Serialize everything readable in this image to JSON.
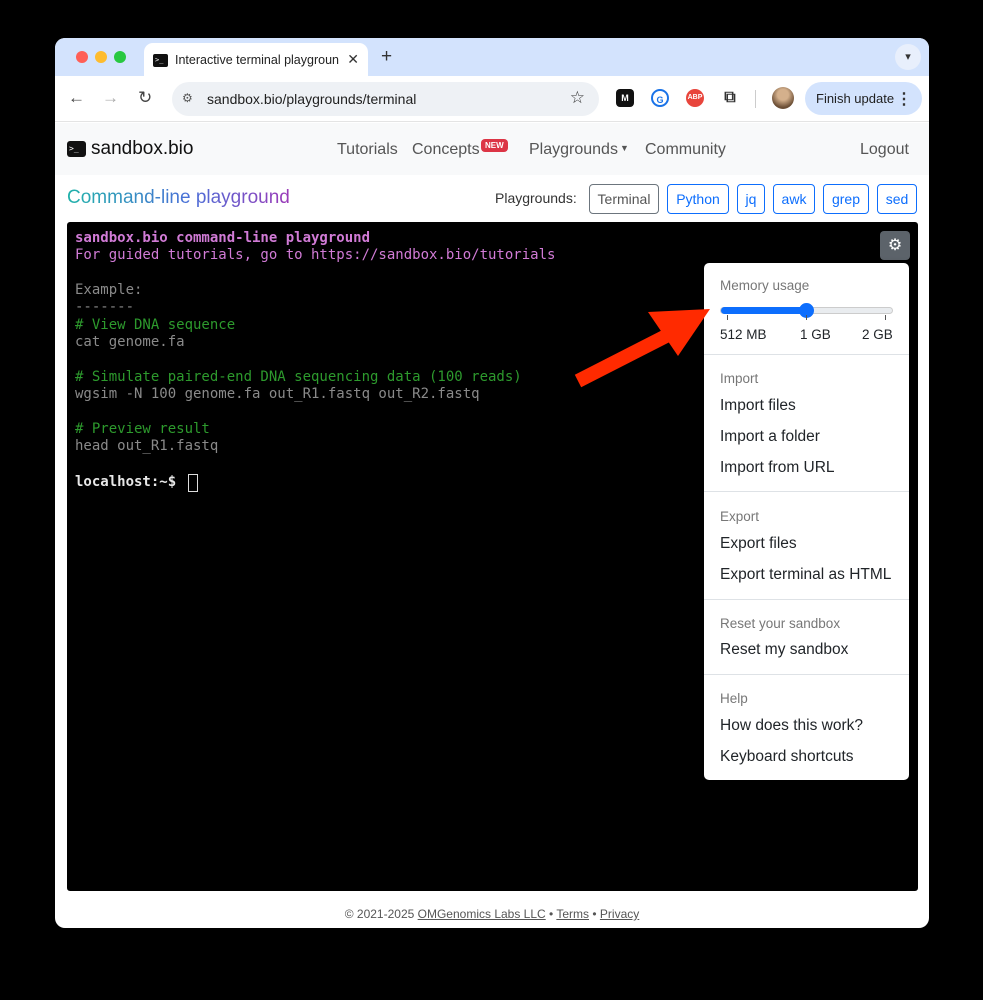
{
  "browser": {
    "tab_title": "Interactive terminal playground",
    "tab_close": "✕",
    "new_tab": "+",
    "url": "sandbox.bio/playgrounds/terminal",
    "finish_update_label": "Finish update",
    "extensions": [
      "M",
      "G",
      "ABP"
    ]
  },
  "nav": {
    "brand": "sandbox.bio",
    "brand_icon": ">_",
    "items": {
      "tutorials": "Tutorials",
      "concepts": "Concepts",
      "concepts_badge": "NEW",
      "playgrounds": "Playgrounds",
      "community": "Community"
    },
    "logout": "Logout"
  },
  "playground": {
    "title_prefix": "Command-line",
    "title_suffix": " playground",
    "label": "Playgrounds:",
    "buttons": [
      "Terminal",
      "Python",
      "jq",
      "awk",
      "grep",
      "sed"
    ],
    "active": "Terminal"
  },
  "terminal": {
    "lines": [
      "sandbox.bio command-line playground",
      "For guided tutorials, go to https://sandbox.bio/tutorials",
      "Example:",
      "-------",
      "# View DNA sequence",
      "cat genome.fa",
      "# Simulate paired-end DNA sequencing data (100 reads)",
      "wgsim -N 100 genome.fa out_R1.fastq out_R2.fastq",
      "# Preview result",
      "head out_R1.fastq",
      "localhost:~$ "
    ]
  },
  "settings_menu": {
    "memory": {
      "header": "Memory usage",
      "ticks": [
        "512 MB",
        "1 GB",
        "2 GB"
      ],
      "selected": "1 GB",
      "selected_fraction": 0.5
    },
    "import": {
      "header": "Import",
      "items": [
        "Import files",
        "Import a folder",
        "Import from URL"
      ]
    },
    "export": {
      "header": "Export",
      "items": [
        "Export files",
        "Export terminal as HTML"
      ]
    },
    "reset": {
      "header": "Reset your sandbox",
      "items": [
        "Reset my sandbox"
      ]
    },
    "help": {
      "header": "Help",
      "items": [
        "How does this work?",
        "Keyboard shortcuts"
      ]
    }
  },
  "footer": {
    "copyright": "© 2021-2025 ",
    "company": "OMGenomics Labs LLC",
    "sep": " • ",
    "terms": "Terms",
    "privacy": "Privacy"
  },
  "colors": {
    "annotation_arrow": "#ff2a00",
    "accent": "#0d6efd",
    "terminal_bg": "#000000"
  }
}
